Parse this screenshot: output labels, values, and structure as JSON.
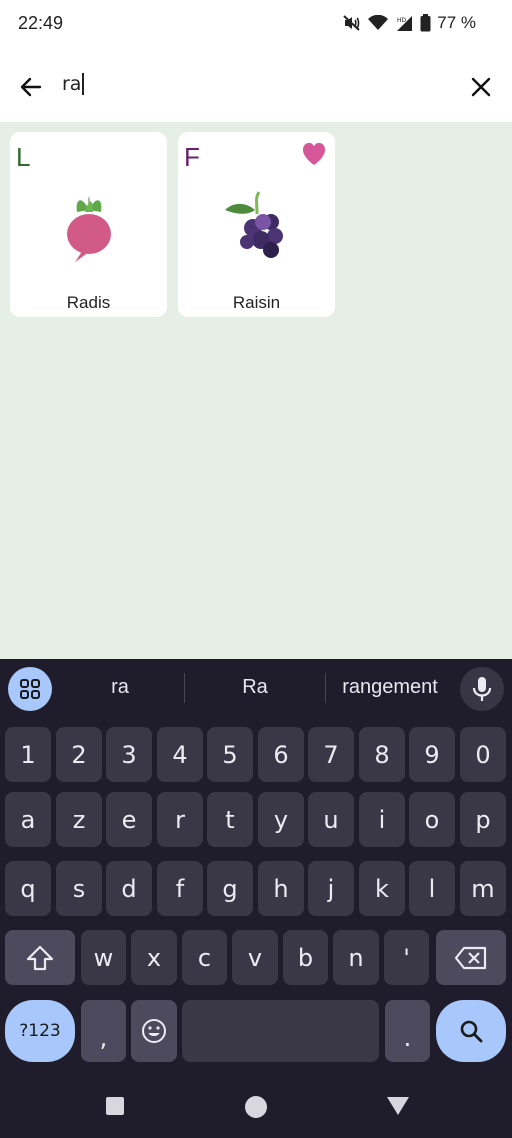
{
  "status_bar": {
    "time": "22:49",
    "battery_percent": "77 %",
    "icons": [
      "mute-vibrate-icon",
      "wifi-icon",
      "hd-signal-icon",
      "battery-icon"
    ]
  },
  "search": {
    "query": "ra"
  },
  "results": [
    {
      "category_letter": "L",
      "name": "Radis",
      "favorite": false,
      "image": "radish-icon",
      "letter_color": "#2e6b2a"
    },
    {
      "category_letter": "F",
      "name": "Raisin",
      "favorite": true,
      "image": "grapes-icon",
      "letter_color": "#6b1f6b"
    }
  ],
  "keyboard": {
    "suggestions": [
      "ra",
      "Ra",
      "rangement"
    ],
    "row_numbers": [
      "1",
      "2",
      "3",
      "4",
      "5",
      "6",
      "7",
      "8",
      "9",
      "0"
    ],
    "row_1": [
      "a",
      "z",
      "e",
      "r",
      "t",
      "y",
      "u",
      "i",
      "o",
      "p"
    ],
    "row_2": [
      "q",
      "s",
      "d",
      "f",
      "g",
      "h",
      "j",
      "k",
      "l",
      "m"
    ],
    "row_3": [
      "w",
      "x",
      "c",
      "v",
      "b",
      "n",
      "'"
    ],
    "symbols_label": "?123",
    "comma": ",",
    "period": "."
  },
  "colors": {
    "accent": "#a8c7fa",
    "background": "#e6efe6",
    "keyboard_bg": "#1f1c2b",
    "favorite": "#d6569a"
  }
}
